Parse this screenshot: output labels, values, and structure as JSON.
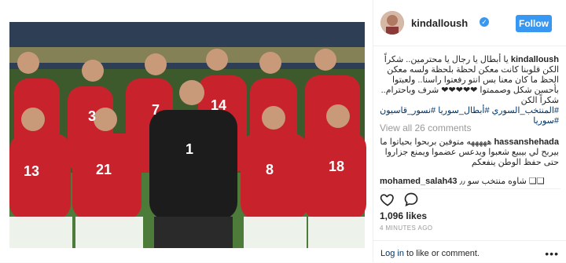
{
  "post": {
    "username": "kindalloush",
    "verified_mark": "✓",
    "follow_label": "Follow",
    "caption_user": "kindalloush",
    "caption_text": "يا أبطال يا رجال يا محترمين.. شكراً الكن قلوبنا كانت معكن لحظة بلحظة ولسه معكن الحظ ما كان معنا بس انتو رفعتوا راسنا.. ولعبتوا بأحسن شكل وصممتوا ❤❤❤❤❤ شرف وباحترام.. شكراً الكن",
    "caption_tags": "#المنتخب_السوري #أبطال_سوريا #نسور_قاسيون #سوريا",
    "view_all_comments": "View all 26 comments",
    "comment1_user": "hassanshehada",
    "comment1_text": "هههههه متوفين بربحوا بحياتوا ما بيربح لي بيبيع شعبوا ويدعس عضموا ويمنع جزاروا حتى حفظ الوطن ينفعكم",
    "comment2_user": "mohamed_salah43",
    "comment2_text": "شاوه منتخب سو ٫٫ ❑❑",
    "likes": "1,096 likes",
    "time": "4 MINUTES AGO",
    "login_link": "Log in",
    "login_rest": " to like or comment.",
    "more": "•••"
  },
  "photo": {
    "jersey_numbers": [
      "3",
      "7",
      "14",
      "1",
      "13",
      "21",
      "8",
      "18"
    ]
  },
  "icons": {
    "like": "heart-icon",
    "comment": "comment-icon",
    "more": "more-icon"
  }
}
